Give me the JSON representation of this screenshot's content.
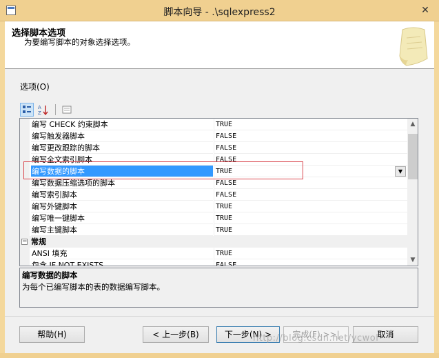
{
  "window": {
    "title": "脚本向导 - .\\sqlexpress2",
    "close_glyph": "✕"
  },
  "header": {
    "title": "选择脚本选项",
    "description": "为要编写脚本的对象选择选项。"
  },
  "options_label": "选项(O)",
  "toolbar": {
    "categorized_icon": "categorized-icon",
    "alphabetical_icon": "alphabetical-icon",
    "property_pages_icon": "property-pages-icon"
  },
  "grid": {
    "rows": [
      {
        "name": "编写 CHECK 约束脚本",
        "value": "TRUE"
      },
      {
        "name": "编写触发器脚本",
        "value": "FALSE"
      },
      {
        "name": "编写更改跟踪的脚本",
        "value": "FALSE"
      },
      {
        "name": "编写全文索引脚本",
        "value": "FALSE"
      },
      {
        "name": "编写数据的脚本",
        "value": "TRUE",
        "selected": true
      },
      {
        "name": "编写数据压缩选项的脚本",
        "value": "FALSE"
      },
      {
        "name": "编写索引脚本",
        "value": "FALSE"
      },
      {
        "name": "编写外键脚本",
        "value": "TRUE"
      },
      {
        "name": "编写唯一键脚本",
        "value": "TRUE"
      },
      {
        "name": "编写主键脚本",
        "value": "TRUE"
      }
    ],
    "category": {
      "name": "常规",
      "toggle": "−"
    },
    "rows_after": [
      {
        "name": "ANSI 填充",
        "value": "TRUE"
      },
      {
        "name": "包含 IF NOT EXISTS",
        "value": "FALSE"
      }
    ]
  },
  "description": {
    "title": "编写数据的脚本",
    "text": "为每个已编写脚本的表的数据编写脚本。"
  },
  "buttons": {
    "help": "帮助(H)",
    "back": "< 上一步(B)",
    "next": "下一步(N) >",
    "finish": "完成(F) >>|",
    "cancel": "取消"
  },
  "watermark": "http://blog.csdn.net/ycwol"
}
